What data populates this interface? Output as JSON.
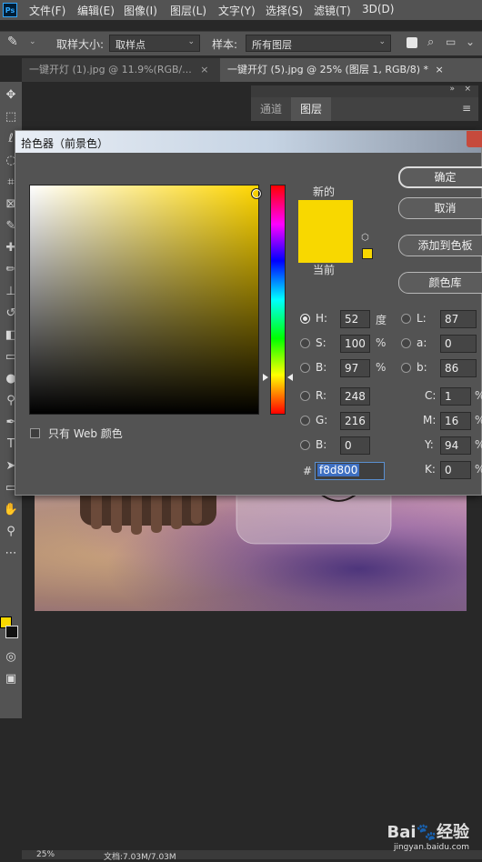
{
  "app": {
    "logo_text": "Ps"
  },
  "menu": {
    "items": [
      "文件(F)",
      "编辑(E)",
      "图像(I)",
      "图层(L)",
      "文字(Y)",
      "选择(S)",
      "滤镜(T)",
      "3D(D)"
    ]
  },
  "options": {
    "size_label": "取样大小:",
    "size_value": "取样点",
    "sample_label": "样本:",
    "sample_value": "所有图层"
  },
  "tabs": [
    {
      "label": "一键开灯 (1).jpg @ 11.9%(RGB/...",
      "close": "×"
    },
    {
      "label": "一键开灯 (5).jpg @ 25% (图层 1, RGB/8) *",
      "close": "×"
    }
  ],
  "panels": {
    "tabs": [
      "通道",
      "图层"
    ]
  },
  "status": {
    "zoom": "25%",
    "doc": "文档:7.03M/7.03M"
  },
  "color_picker": {
    "title": "拾色器（前景色）",
    "new_label": "新的",
    "current_label": "当前",
    "current_color": "#f8d800",
    "buttons": {
      "ok": "确定",
      "cancel": "取消",
      "add_swatch": "添加到色板",
      "libraries": "颜色库"
    },
    "web_only_label": "只有 Web 颜色",
    "hsb": [
      {
        "label": "H:",
        "value": "52",
        "unit": "度",
        "selected": true
      },
      {
        "label": "S:",
        "value": "100",
        "unit": "%",
        "selected": false
      },
      {
        "label": "B:",
        "value": "97",
        "unit": "%",
        "selected": false
      }
    ],
    "rgb": [
      {
        "label": "R:",
        "value": "248"
      },
      {
        "label": "G:",
        "value": "216"
      },
      {
        "label": "B:",
        "value": "0"
      }
    ],
    "lab": [
      {
        "label": "L:",
        "value": "87"
      },
      {
        "label": "a:",
        "value": "0"
      },
      {
        "label": "b:",
        "value": "86"
      }
    ],
    "cmyk": [
      {
        "label": "C:",
        "value": "1",
        "unit": "%"
      },
      {
        "label": "M:",
        "value": "16",
        "unit": "%"
      },
      {
        "label": "Y:",
        "value": "94",
        "unit": "%"
      },
      {
        "label": "K:",
        "value": "0",
        "unit": "%"
      }
    ],
    "hex_label": "#",
    "hex_value": "f8d800"
  },
  "watermark": {
    "brand": "Bai🐾经验",
    "url": "jingyan.baidu.com"
  }
}
